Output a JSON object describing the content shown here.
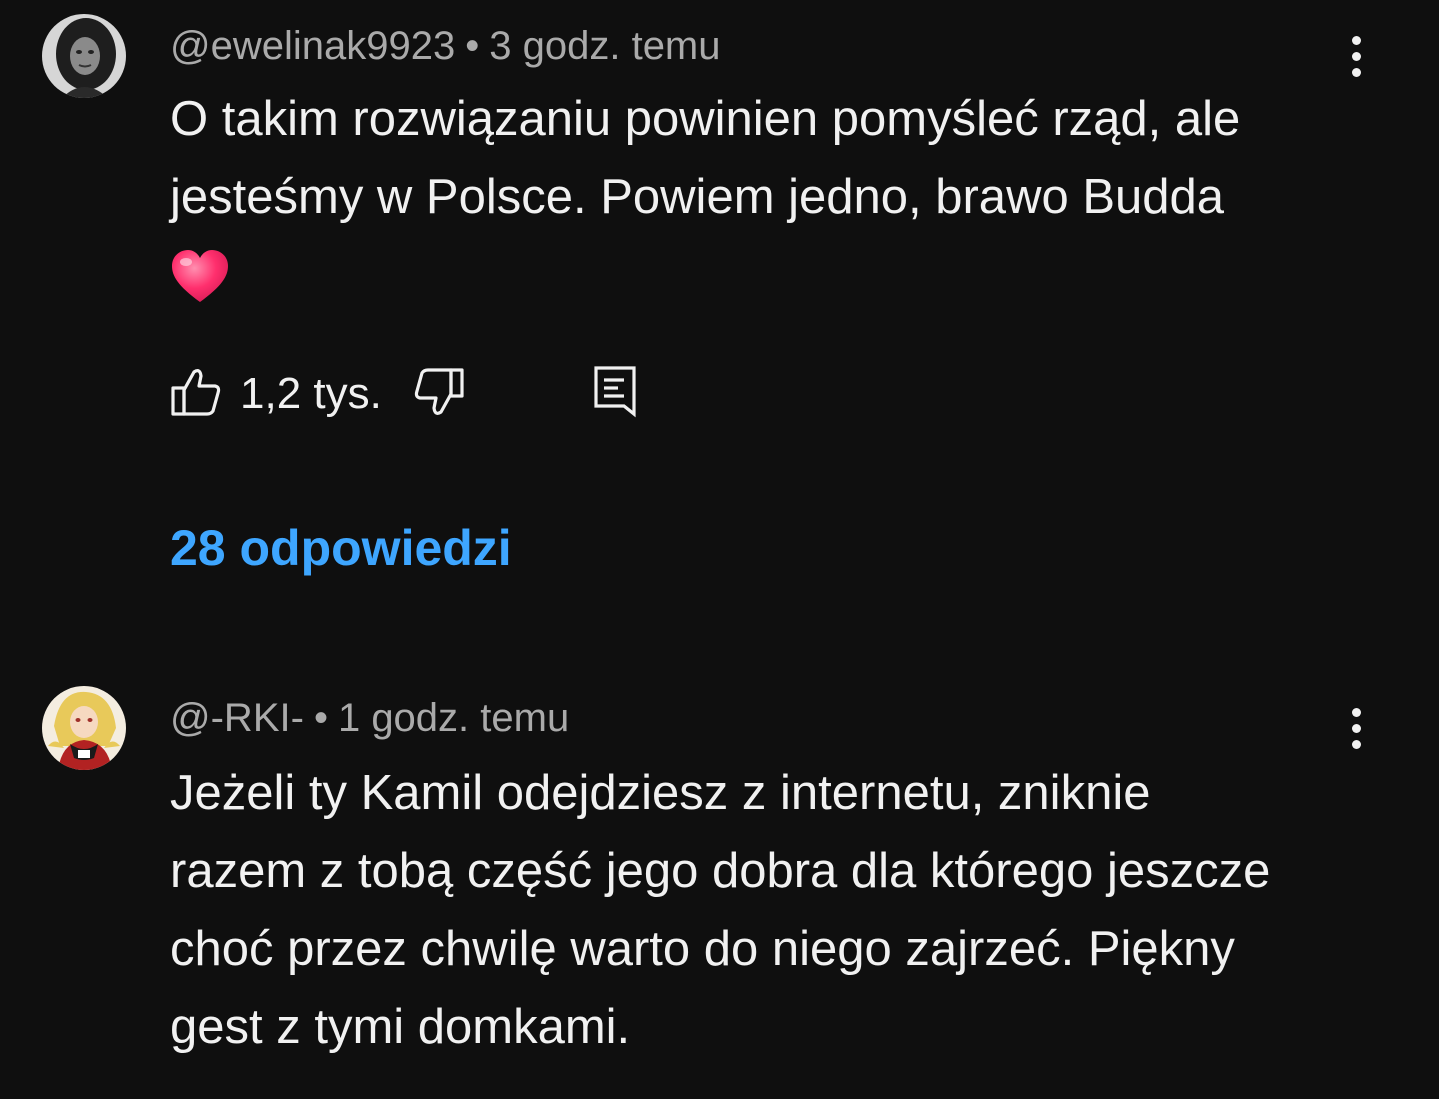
{
  "comments": [
    {
      "author": "@ewelinak9923",
      "separator": "•",
      "time": "3 godz. temu",
      "text": "O takim rozwiązaniu powinien pomyśleć rząd, ale jesteśmy w Polsce. Powiem jedno, brawo Budda",
      "emoji": "heart-emoji",
      "like_count": "1,2 tys.",
      "replies_label": "28 odpowiedzi",
      "icons": {
        "like": "thumbs-up-icon",
        "dislike": "thumbs-down-icon",
        "reply": "comment-reply-icon",
        "menu": "more-vert-icon"
      }
    },
    {
      "author": "@-RKI-",
      "separator": "•",
      "time": "1 godz. temu",
      "text": "Jeżeli ty Kamil odejdziesz z internetu, zniknie razem z tobą część jego dobra dla którego jeszcze choć przez chwilę warto do niego zajrzeć. Piękny gest z tymi domkami.",
      "icons": {
        "menu": "more-vert-icon"
      }
    }
  ],
  "colors": {
    "background": "#0f0f0f",
    "primary_text": "#f1f1f1",
    "secondary_text": "#aaaaaa",
    "link": "#3ea6ff"
  }
}
